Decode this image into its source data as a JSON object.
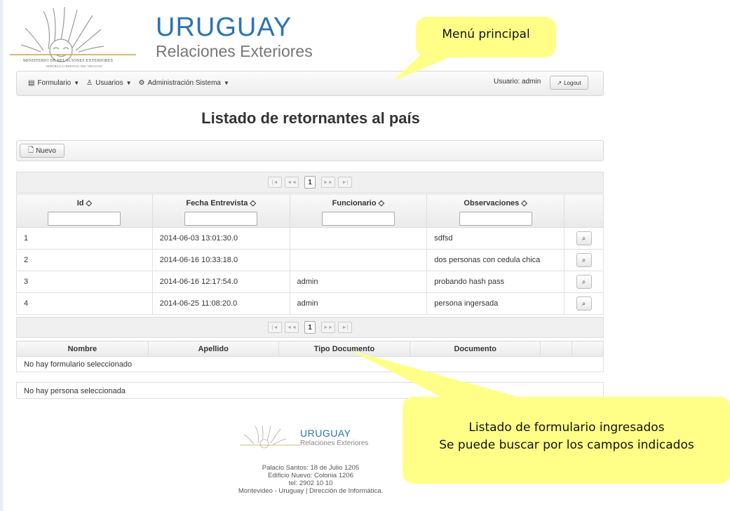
{
  "header": {
    "brand_title": "URUGUAY",
    "brand_subtitle": "Relaciones Exteriores",
    "ministry_line1": "MINISTERIO DE RELACIONES EXTERIORES",
    "ministry_line2": "REPÚBLICA ORIENTAL DEL URUGUAY"
  },
  "navbar": {
    "items": [
      {
        "label": "Formulario",
        "icon": "form-icon"
      },
      {
        "label": "Usuarios",
        "icon": "user-icon"
      },
      {
        "label": "Administración Sistema",
        "icon": "gear-icon"
      }
    ],
    "user_label": "Usuario: admin",
    "logout_label": "Logout"
  },
  "page_title": "Listado de retornantes al país",
  "toolbar": {
    "nuevo_label": "Nuevo"
  },
  "paginator": {
    "current_page": "1",
    "first": "|◄",
    "prev": "◄◄",
    "next": "►►",
    "last": "►|"
  },
  "table": {
    "columns": [
      "Id ◇",
      "Fecha Entrevista ◇",
      "Funcionario ◇",
      "Observaciones ◇"
    ],
    "rows": [
      {
        "id": "1",
        "fecha": "2014-06-03 13:01:30.0",
        "funcionario": "",
        "observaciones": "sdfsd"
      },
      {
        "id": "2",
        "fecha": "2014-06-16 10:33:18.0",
        "funcionario": "",
        "observaciones": "dos personas con cedula chica"
      },
      {
        "id": "3",
        "fecha": "2014-06-16 12:17:54.0",
        "funcionario": "admin",
        "observaciones": "probando hash pass"
      },
      {
        "id": "4",
        "fecha": "2014-06-25 11:08:20.0",
        "funcionario": "admin",
        "observaciones": "persona ingersada"
      }
    ]
  },
  "second_table": {
    "columns": [
      "Nombre",
      "Apellido",
      "Tipo Documento",
      "Documento"
    ],
    "empty_message": "No hay formulario seleccionado"
  },
  "persona_message": "No hay persona seleccionada",
  "footer": {
    "brand_title": "URUGUAY",
    "brand_subtitle": "Relaciones Exteriores",
    "line1": "Palacio Santos: 18 de Julio 1205",
    "line2": "Edificio Nuevo: Colonia 1206",
    "line3": "tel: 2902 10 10",
    "line4": "Montevideo - Uruguay | Dirección de Informática."
  },
  "callouts": {
    "menu": "Menú principal",
    "list_line1": "Listado de formulario ingresados",
    "list_line2": "Se puede buscar por los campos indicados"
  },
  "colors": {
    "brand_blue": "#2a73b5",
    "callout_yellow": "#ffff88"
  }
}
